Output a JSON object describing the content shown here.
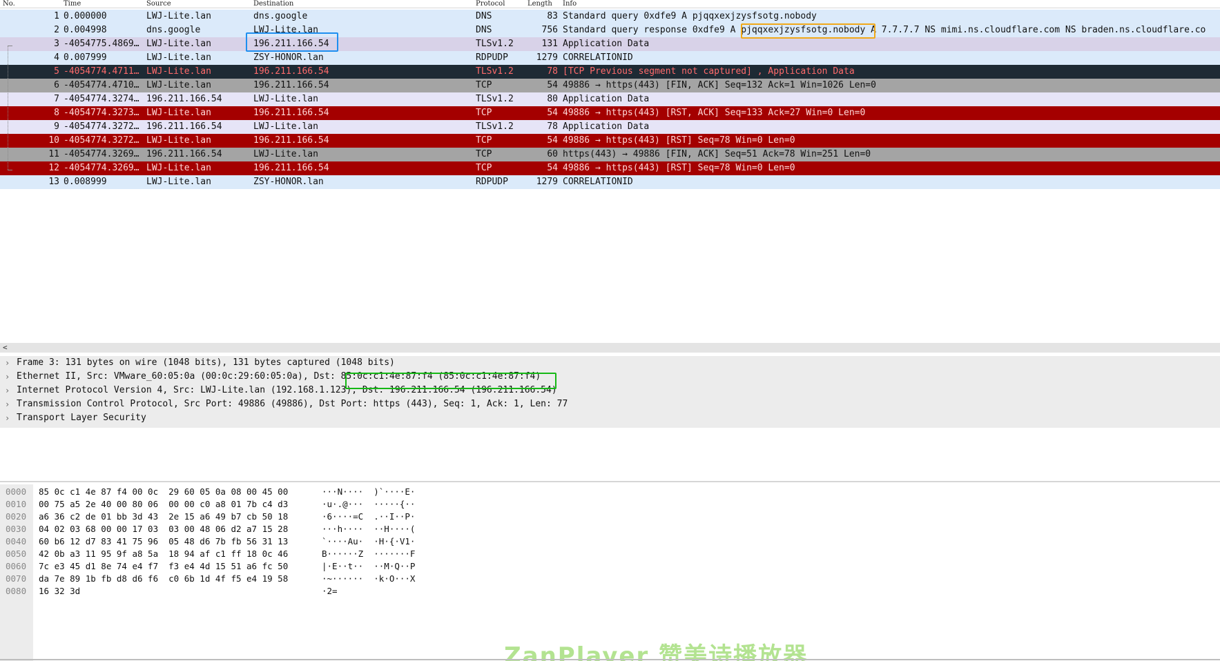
{
  "columns": {
    "no": "No.",
    "time": "Time",
    "source": "Source",
    "destination": "Destination",
    "protocol": "Protocol",
    "length": "Length",
    "info": "Info"
  },
  "packets": [
    {
      "no": "1",
      "time": "0.000000",
      "source": "LWJ-Lite.lan",
      "destination": "dns.google",
      "protocol": "DNS",
      "length": "83",
      "info": "Standard query 0xdfe9 A pjqqxexjzysfsotg.nobody",
      "style": "lightblue"
    },
    {
      "no": "2",
      "time": "0.004998",
      "source": "dns.google",
      "destination": "LWJ-Lite.lan",
      "protocol": "DNS",
      "length": "756",
      "info": "Standard query response 0xdfe9 A pjqqxexjzysfsotg.nobody A 7.7.7.7 NS mimi.ns.cloudflare.com NS braden.ns.cloudflare.co",
      "style": "lightblue"
    },
    {
      "no": "3",
      "time": "-4054775.4869…",
      "source": "LWJ-Lite.lan",
      "destination": "196.211.166.54",
      "protocol": "TLSv1.2",
      "length": "131",
      "info": "Application Data",
      "style": "lavender"
    },
    {
      "no": "4",
      "time": "0.007999",
      "source": "LWJ-Lite.lan",
      "destination": "ZSY-HONOR.lan",
      "protocol": "RDPUDP",
      "length": "1279",
      "info": "CORRELATIONID",
      "style": "lightblue"
    },
    {
      "no": "5",
      "time": "-4054774.4711…",
      "source": "LWJ-Lite.lan",
      "destination": "196.211.166.54",
      "protocol": "TLSv1.2",
      "length": "78",
      "info": "[TCP Previous segment not captured] , Application Data",
      "style": "dark"
    },
    {
      "no": "6",
      "time": "-4054774.4710…",
      "source": "LWJ-Lite.lan",
      "destination": "196.211.166.54",
      "protocol": "TCP",
      "length": "54",
      "info": "49886 → https(443) [FIN, ACK] Seq=132 Ack=1 Win=1026 Len=0",
      "style": "gray"
    },
    {
      "no": "7",
      "time": "-4054774.3274…",
      "source": "196.211.166.54",
      "destination": "LWJ-Lite.lan",
      "protocol": "TLSv1.2",
      "length": "80",
      "info": "Application Data",
      "style": "lavender2"
    },
    {
      "no": "8",
      "time": "-4054774.3273…",
      "source": "LWJ-Lite.lan",
      "destination": "196.211.166.54",
      "protocol": "TCP",
      "length": "54",
      "info": "49886 → https(443) [RST, ACK] Seq=133 Ack=27 Win=0 Len=0",
      "style": "red"
    },
    {
      "no": "9",
      "time": "-4054774.3272…",
      "source": "196.211.166.54",
      "destination": "LWJ-Lite.lan",
      "protocol": "TLSv1.2",
      "length": "78",
      "info": "Application Data",
      "style": "lavender2"
    },
    {
      "no": "10",
      "time": "-4054774.3272…",
      "source": "LWJ-Lite.lan",
      "destination": "196.211.166.54",
      "protocol": "TCP",
      "length": "54",
      "info": "49886 → https(443) [RST] Seq=78 Win=0 Len=0",
      "style": "red"
    },
    {
      "no": "11",
      "time": "-4054774.3269…",
      "source": "196.211.166.54",
      "destination": "LWJ-Lite.lan",
      "protocol": "TCP",
      "length": "60",
      "info": "https(443) → 49886 [FIN, ACK] Seq=51 Ack=78 Win=251 Len=0",
      "style": "gray"
    },
    {
      "no": "12",
      "time": "-4054774.3269…",
      "source": "LWJ-Lite.lan",
      "destination": "196.211.166.54",
      "protocol": "TCP",
      "length": "54",
      "info": "49886 → https(443) [RST] Seq=78 Win=0 Len=0",
      "style": "red"
    },
    {
      "no": "13",
      "time": "0.008999",
      "source": "LWJ-Lite.lan",
      "destination": "ZSY-HONOR.lan",
      "protocol": "RDPUDP",
      "length": "1279",
      "info": "CORRELATIONID",
      "style": "lightblue"
    }
  ],
  "details": [
    "Frame 3: 131 bytes on wire (1048 bits), 131 bytes captured (1048 bits)",
    "Ethernet II, Src: VMware_60:05:0a (00:0c:29:60:05:0a), Dst: 85:0c:c1:4e:87:f4 (85:0c:c1:4e:87:f4)",
    "Internet Protocol Version 4, Src: LWJ-Lite.lan (192.168.1.123), Dst: 196.211.166.54 (196.211.166.54)",
    "Transmission Control Protocol, Src Port: 49886 (49886), Dst Port: https (443), Seq: 1, Ack: 1, Len: 77",
    "Transport Layer Security"
  ],
  "bytes": [
    {
      "offset": "0000",
      "hex": "85 0c c1 4e 87 f4 00 0c  29 60 05 0a 08 00 45 00",
      "ascii": "···N····  )`····E·"
    },
    {
      "offset": "0010",
      "hex": "00 75 a5 2e 40 00 80 06  00 00 c0 a8 01 7b c4 d3",
      "ascii": "·u·.@···  ·····{··"
    },
    {
      "offset": "0020",
      "hex": "a6 36 c2 de 01 bb 3d 43  2e 15 a6 49 b7 cb 50 18",
      "ascii": "·6····=C  .··I··P·"
    },
    {
      "offset": "0030",
      "hex": "04 02 03 68 00 00 17 03  03 00 48 06 d2 a7 15 28",
      "ascii": "···h····  ··H····("
    },
    {
      "offset": "0040",
      "hex": "60 b6 12 d7 83 41 75 96  05 48 d6 7b fb 56 31 13",
      "ascii": "`····Au·  ·H·{·V1·"
    },
    {
      "offset": "0050",
      "hex": "42 0b a3 11 95 9f a8 5a  18 94 af c1 ff 18 0c 46",
      "ascii": "B······Z  ·······F"
    },
    {
      "offset": "0060",
      "hex": "7c e3 45 d1 8e 74 e4 f7  f3 e4 4d 15 51 a6 fc 50",
      "ascii": "|·E··t··  ··M·Q··P"
    },
    {
      "offset": "0070",
      "hex": "da 7e 89 1b fb d8 d6 f6  c0 6b 1d 4f f5 e4 19 58",
      "ascii": "·~······  ·k·O···X"
    },
    {
      "offset": "0080",
      "hex": "16 32 3d",
      "ascii": "·2="
    }
  ],
  "watermark": "ZanPlayer 赞美诗播放器",
  "colors": {
    "lightblue": "#dbeafa",
    "lavender": "#d8d2e8",
    "dark": "#1e2a34",
    "gray": "#a4a4a4",
    "red": "#a40000",
    "highlight_blue": "#1e8ff0",
    "highlight_orange": "#f0a818",
    "highlight_green": "#15b815"
  },
  "icons": {
    "scroll_left": "chevron-left-icon",
    "expand": "chevron-right-icon"
  }
}
